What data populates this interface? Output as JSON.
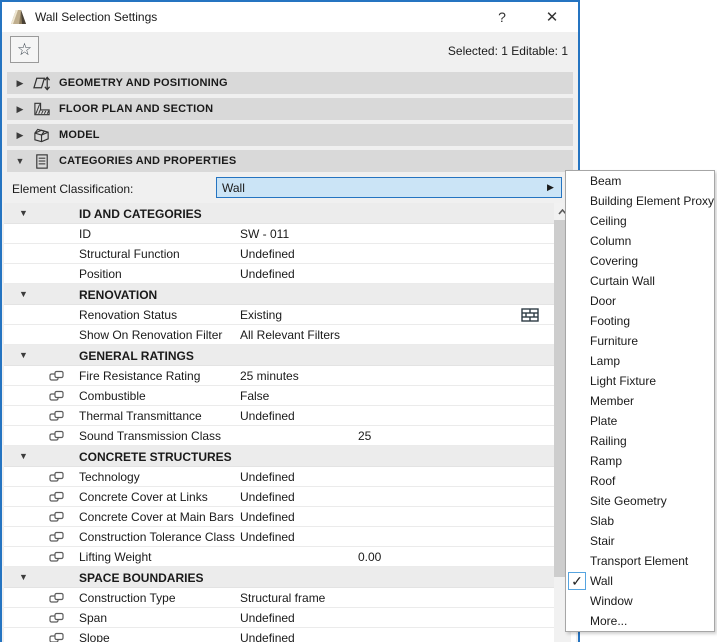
{
  "window": {
    "title": "Wall Selection Settings",
    "help_label": "?",
    "close_label": "✕"
  },
  "toolbar": {
    "favorites_icon": "star-icon",
    "favorites_glyph": "☆",
    "selection_status": "Selected: 1 Editable: 1"
  },
  "sections": [
    {
      "label": "GEOMETRY AND POSITIONING",
      "icon": "geometry-positioning-icon",
      "expanded": false
    },
    {
      "label": "FLOOR PLAN AND SECTION",
      "icon": "floor-plan-section-icon",
      "expanded": false
    },
    {
      "label": "MODEL",
      "icon": "model-icon",
      "expanded": false
    },
    {
      "label": "CATEGORIES AND PROPERTIES",
      "icon": "categories-properties-icon",
      "expanded": true
    }
  ],
  "classification": {
    "label": "Element Classification:",
    "value": "Wall",
    "arrow_glyph": "▶"
  },
  "properties": {
    "rows": [
      {
        "type": "group",
        "name": "ID AND CATEGORIES"
      },
      {
        "type": "prop",
        "name": "ID",
        "value": "SW - 011"
      },
      {
        "type": "prop",
        "name": "Structural Function",
        "value": "Undefined"
      },
      {
        "type": "prop",
        "name": "Position",
        "value": "Undefined"
      },
      {
        "type": "group",
        "name": "RENOVATION"
      },
      {
        "type": "prop",
        "name": "Renovation Status",
        "value": "Existing",
        "trailing_icon": "brick-wall-icon"
      },
      {
        "type": "prop",
        "name": "Show On Renovation Filter",
        "value": "All Relevant Filters"
      },
      {
        "type": "group",
        "name": "GENERAL RATINGS"
      },
      {
        "type": "prop",
        "name": "Fire Resistance Rating",
        "value": "25 minutes",
        "linked": true
      },
      {
        "type": "prop",
        "name": "Combustible",
        "value": "False",
        "linked": true
      },
      {
        "type": "prop",
        "name": "Thermal Transmittance",
        "value": "Undefined",
        "linked": true
      },
      {
        "type": "prop",
        "name": "Sound Transmission Class",
        "value": "25",
        "numeric": true,
        "linked": true
      },
      {
        "type": "group",
        "name": "CONCRETE STRUCTURES"
      },
      {
        "type": "prop",
        "name": "Technology",
        "value": "Undefined",
        "linked": true
      },
      {
        "type": "prop",
        "name": "Concrete Cover at Links",
        "value": "Undefined",
        "linked": true
      },
      {
        "type": "prop",
        "name": "Concrete Cover at Main Bars",
        "value": "Undefined",
        "linked": true
      },
      {
        "type": "prop",
        "name": "Construction Tolerance Class",
        "value": "Undefined",
        "linked": true
      },
      {
        "type": "prop",
        "name": "Lifting Weight",
        "value": "0.00",
        "numeric": true,
        "linked": true
      },
      {
        "type": "group",
        "name": "SPACE BOUNDARIES"
      },
      {
        "type": "prop",
        "name": "Construction Type",
        "value": "Structural frame",
        "linked": true
      },
      {
        "type": "prop",
        "name": "Span",
        "value": "Undefined",
        "linked": true
      },
      {
        "type": "prop",
        "name": "Slope",
        "value": "Undefined",
        "linked": true
      }
    ]
  },
  "dropdown": {
    "selected": "Wall",
    "check_glyph": "✓",
    "items": [
      "Beam",
      "Building Element Proxy",
      "Ceiling",
      "Column",
      "Covering",
      "Curtain Wall",
      "Door",
      "Footing",
      "Furniture",
      "Lamp",
      "Light Fixture",
      "Member",
      "Plate",
      "Railing",
      "Ramp",
      "Roof",
      "Site Geometry",
      "Slab",
      "Stair",
      "Transport Element",
      "Wall",
      "Window",
      "More..."
    ]
  },
  "colors": {
    "accent_border": "#2574c1",
    "combo_fill": "#cbe4f6",
    "section_bar": "#d9d9d9",
    "group_row": "#ececec",
    "scroll_thumb": "#cdcdcd",
    "check_box_border": "#56a4e0"
  }
}
